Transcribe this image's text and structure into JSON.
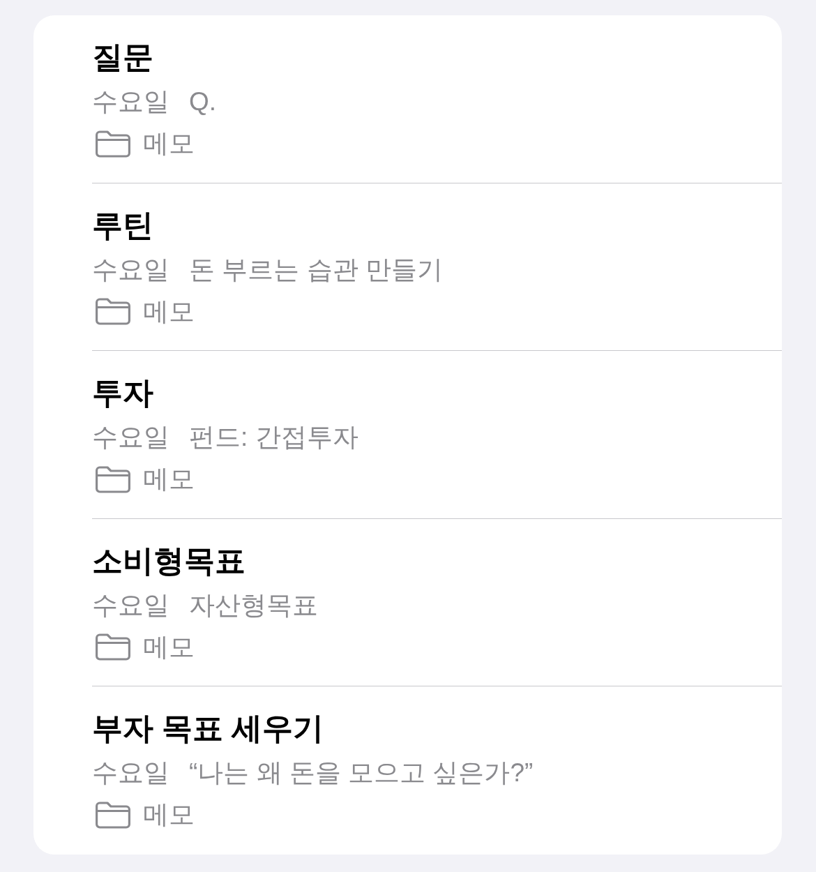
{
  "notes": [
    {
      "title": "질문",
      "date": "수요일",
      "preview": "Q.",
      "folder": "메모"
    },
    {
      "title": "루틴",
      "date": "수요일",
      "preview": "돈 부르는 습관 만들기",
      "folder": "메모"
    },
    {
      "title": "투자",
      "date": "수요일",
      "preview": "펀드: 간접투자",
      "folder": "메모"
    },
    {
      "title": "소비형목표",
      "date": "수요일",
      "preview": "자산형목표",
      "folder": "메모"
    },
    {
      "title": "부자 목표 세우기",
      "date": "수요일",
      "preview": "“나는 왜 돈을 모으고 싶은가?”",
      "folder": "메모"
    }
  ]
}
